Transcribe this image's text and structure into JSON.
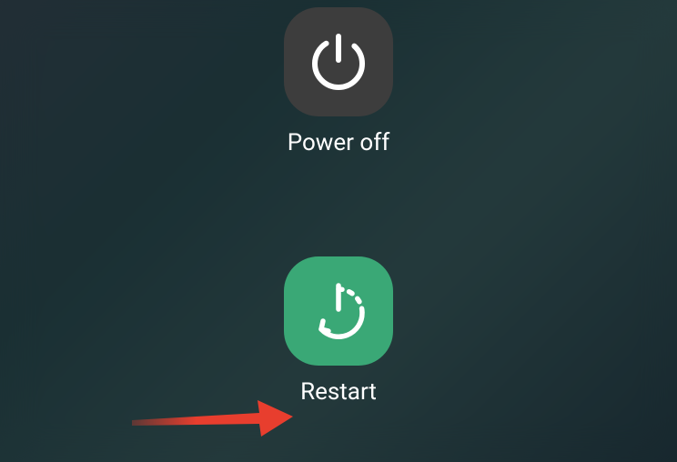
{
  "power_menu": {
    "items": [
      {
        "label": "Power off",
        "icon": "power-icon"
      },
      {
        "label": "Restart",
        "icon": "restart-icon"
      }
    ]
  },
  "annotation": {
    "type": "arrow",
    "color": "#e83e2e",
    "target": "restart-button"
  }
}
